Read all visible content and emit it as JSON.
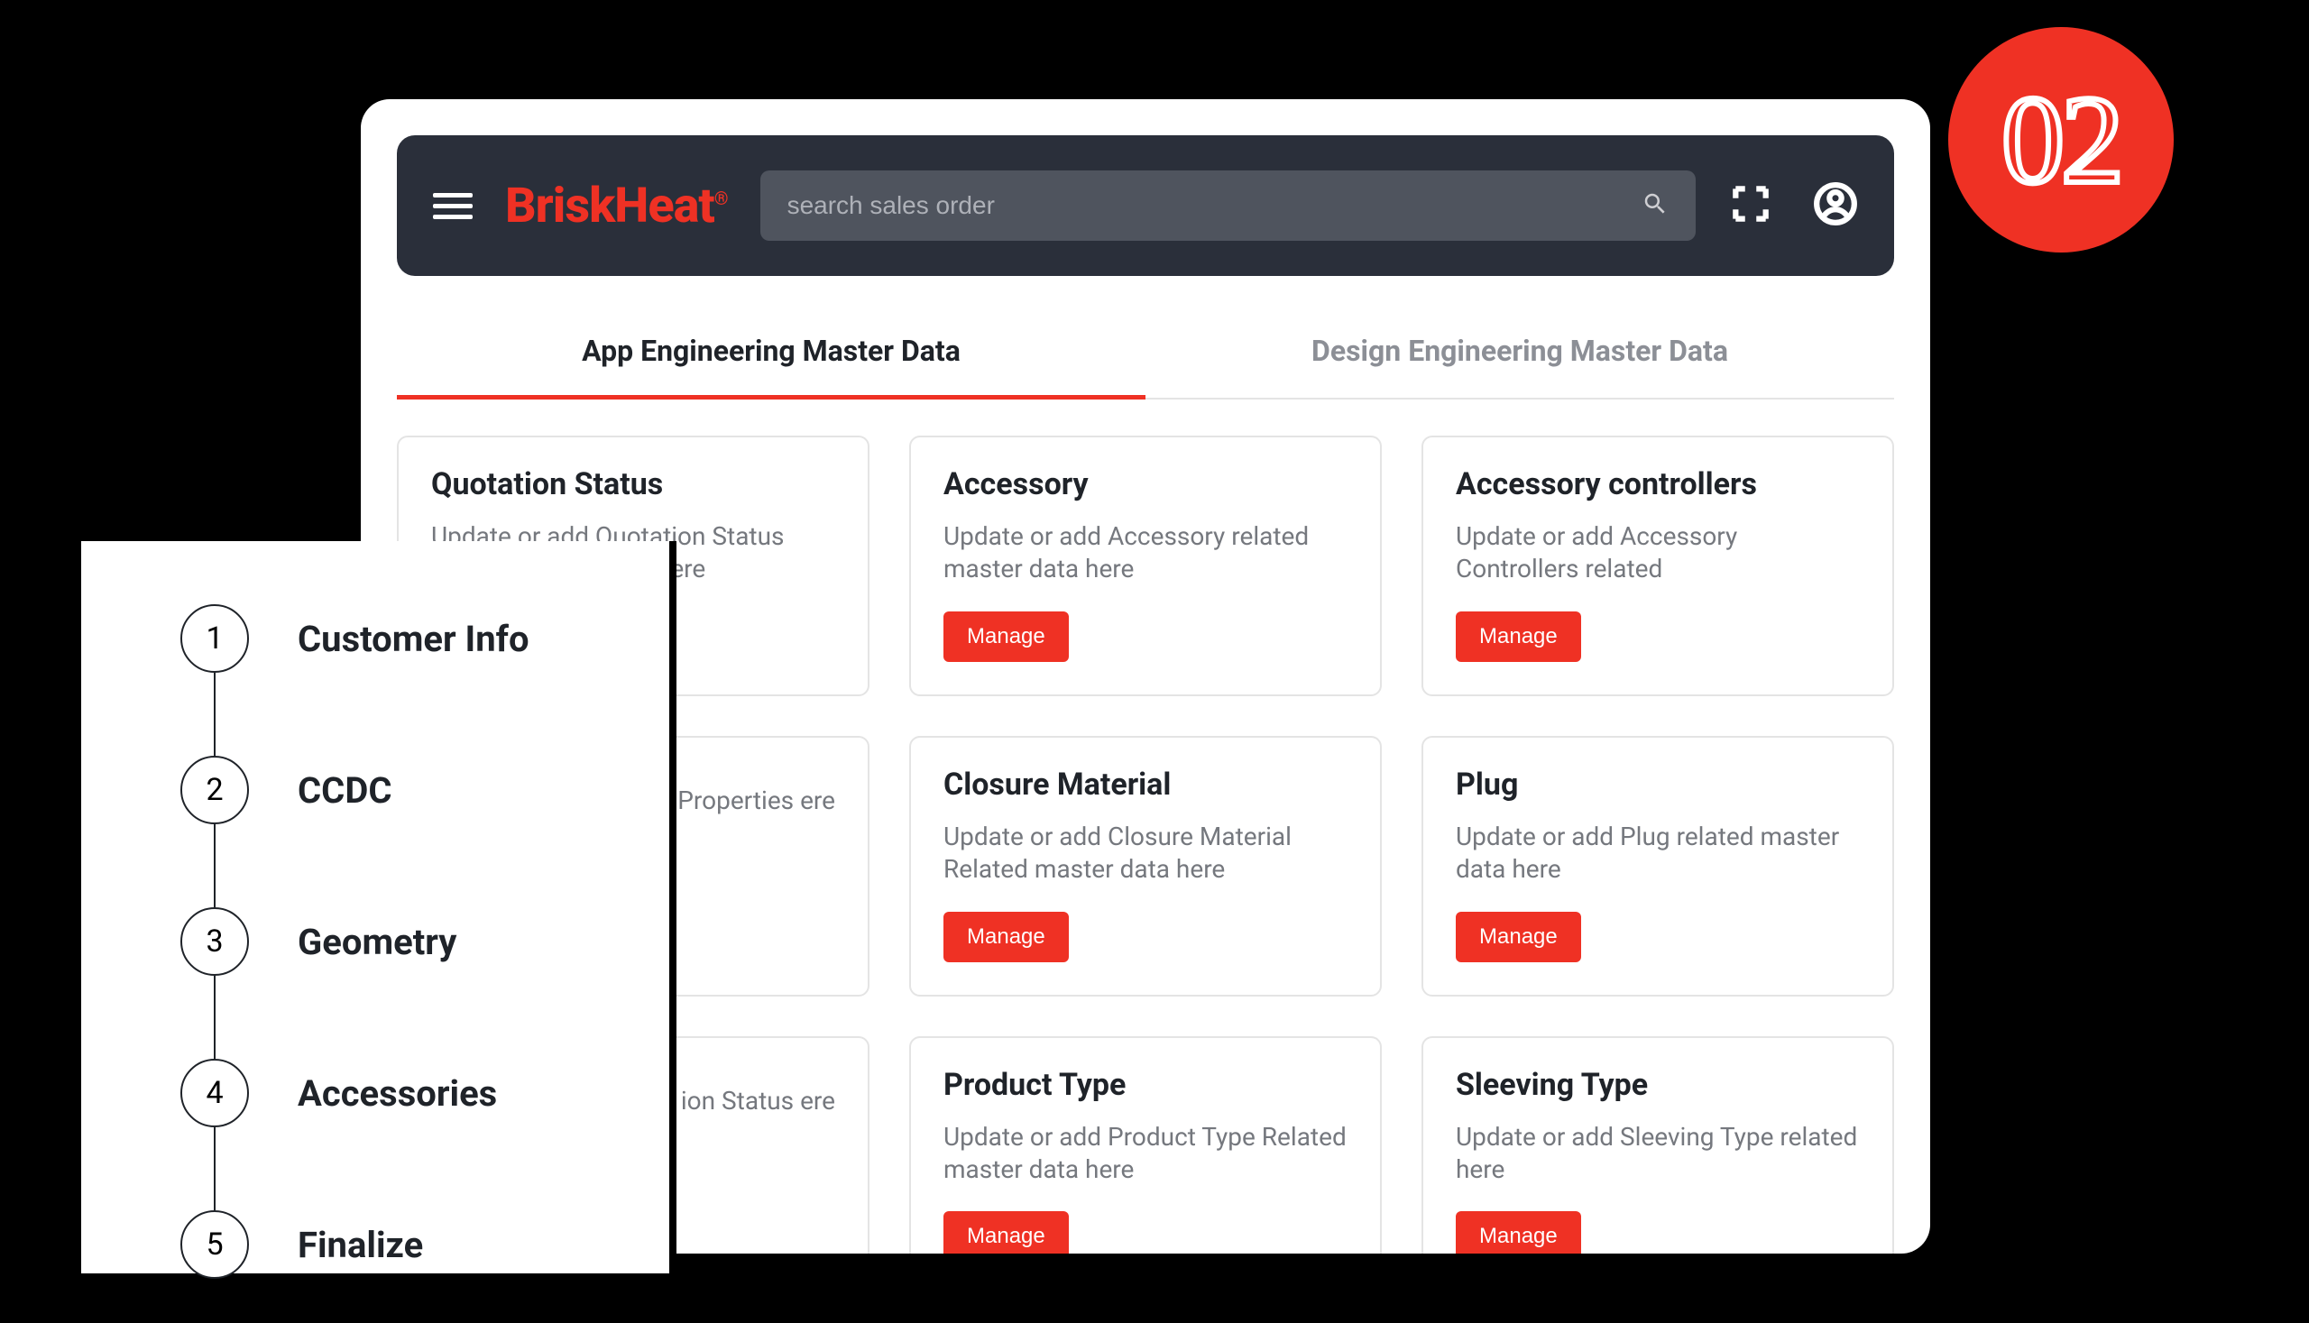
{
  "bubble": {
    "number": "02"
  },
  "brand": {
    "name": "BriskHeat",
    "reg": "®"
  },
  "search": {
    "placeholder": "search sales order"
  },
  "tabs": [
    {
      "label": "App Engineering Master Data",
      "active": true
    },
    {
      "label": "Design Engineering Master Data",
      "active": false
    }
  ],
  "cards": [
    {
      "title": "Quotation Status",
      "desc": "Update or add Quotation Status related master data here",
      "manage": false
    },
    {
      "title": "Accessory",
      "desc": "Update or add Accessory related master data here",
      "manage": true
    },
    {
      "title": "Accessory controllers",
      "desc": "Update or add Accessory Controllers related",
      "manage": true
    },
    {
      "title": "",
      "desc": "al Properties ere",
      "manage": false,
      "partial": true
    },
    {
      "title": "Closure Material",
      "desc": "Update or add Closure Material Related master data here",
      "manage": true
    },
    {
      "title": "Plug",
      "desc": "Update or add Plug related master data here",
      "manage": true
    },
    {
      "title": "",
      "desc": "ion Status ere",
      "manage": false,
      "partial": true
    },
    {
      "title": "Product Type",
      "desc": "Update or add Product Type Related master data here",
      "manage": true
    },
    {
      "title": "Sleeving Type",
      "desc": "Update or add Sleeving Type related here",
      "manage": true
    }
  ],
  "manage_label": "Manage",
  "steps": [
    {
      "num": "1",
      "label": "Customer Info"
    },
    {
      "num": "2",
      "label": "CCDC"
    },
    {
      "num": "3",
      "label": "Geometry"
    },
    {
      "num": "4",
      "label": "Accessories"
    },
    {
      "num": "5",
      "label": "Finalize"
    }
  ]
}
